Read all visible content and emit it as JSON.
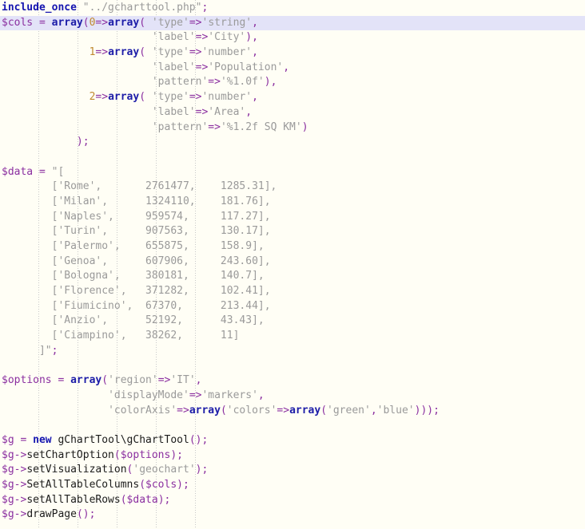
{
  "editor": {
    "title": "PHP Code Listing",
    "language": "php",
    "background_color": "#fffef5",
    "highlight_row_color": "#e3e3f8",
    "indent_guide_color": "#c9c9c9",
    "highlighted_line_index": 1,
    "indent_guide_x": [
      48,
      97,
      146,
      195,
      244
    ],
    "colors": {
      "keyword": "#1515b0",
      "function": "#1c1ca8",
      "variable": "#8b2fa0",
      "string": "#9a9a9a",
      "number": "#c08a30",
      "operator": "#8b2fa0",
      "plain": "#1c1c1c"
    },
    "lines": [
      [
        {
          "t": "include_once",
          "c": "kw"
        },
        {
          "t": " ",
          "c": "plain"
        },
        {
          "t": "\"../gcharttool.php\"",
          "c": "str"
        },
        {
          "t": ";",
          "c": "punc"
        }
      ],
      [
        {
          "t": "$cols",
          "c": "var"
        },
        {
          "t": " ",
          "c": "plain"
        },
        {
          "t": "=",
          "c": "op"
        },
        {
          "t": " ",
          "c": "plain"
        },
        {
          "t": "array",
          "c": "fn"
        },
        {
          "t": "(",
          "c": "punc"
        },
        {
          "t": "0",
          "c": "num"
        },
        {
          "t": "=>",
          "c": "op"
        },
        {
          "t": "array",
          "c": "fn"
        },
        {
          "t": "( ",
          "c": "punc"
        },
        {
          "t": "'type'",
          "c": "str"
        },
        {
          "t": "=>",
          "c": "op"
        },
        {
          "t": "'string'",
          "c": "str"
        },
        {
          "t": ",",
          "c": "punc"
        }
      ],
      [
        {
          "t": "                        ",
          "c": "plain"
        },
        {
          "t": "'label'",
          "c": "str"
        },
        {
          "t": "=>",
          "c": "op"
        },
        {
          "t": "'City'",
          "c": "str"
        },
        {
          "t": "),",
          "c": "punc"
        }
      ],
      [
        {
          "t": "              ",
          "c": "plain"
        },
        {
          "t": "1",
          "c": "num"
        },
        {
          "t": "=>",
          "c": "op"
        },
        {
          "t": "array",
          "c": "fn"
        },
        {
          "t": "( ",
          "c": "punc"
        },
        {
          "t": "'type'",
          "c": "str"
        },
        {
          "t": "=>",
          "c": "op"
        },
        {
          "t": "'number'",
          "c": "str"
        },
        {
          "t": ",",
          "c": "punc"
        }
      ],
      [
        {
          "t": "                        ",
          "c": "plain"
        },
        {
          "t": "'label'",
          "c": "str"
        },
        {
          "t": "=>",
          "c": "op"
        },
        {
          "t": "'Population'",
          "c": "str"
        },
        {
          "t": ",",
          "c": "punc"
        }
      ],
      [
        {
          "t": "                        ",
          "c": "plain"
        },
        {
          "t": "'pattern'",
          "c": "str"
        },
        {
          "t": "=>",
          "c": "op"
        },
        {
          "t": "'%1.0f'",
          "c": "str"
        },
        {
          "t": "),",
          "c": "punc"
        }
      ],
      [
        {
          "t": "              ",
          "c": "plain"
        },
        {
          "t": "2",
          "c": "num"
        },
        {
          "t": "=>",
          "c": "op"
        },
        {
          "t": "array",
          "c": "fn"
        },
        {
          "t": "( ",
          "c": "punc"
        },
        {
          "t": "'type'",
          "c": "str"
        },
        {
          "t": "=>",
          "c": "op"
        },
        {
          "t": "'number'",
          "c": "str"
        },
        {
          "t": ",",
          "c": "punc"
        }
      ],
      [
        {
          "t": "                        ",
          "c": "plain"
        },
        {
          "t": "'label'",
          "c": "str"
        },
        {
          "t": "=>",
          "c": "op"
        },
        {
          "t": "'Area'",
          "c": "str"
        },
        {
          "t": ",",
          "c": "punc"
        }
      ],
      [
        {
          "t": "                        ",
          "c": "plain"
        },
        {
          "t": "'pattern'",
          "c": "str"
        },
        {
          "t": "=>",
          "c": "op"
        },
        {
          "t": "'%1.2f SQ KM'",
          "c": "str"
        },
        {
          "t": ")",
          "c": "punc"
        }
      ],
      [
        {
          "t": "            ",
          "c": "plain"
        },
        {
          "t": ");",
          "c": "punc"
        }
      ],
      [],
      [
        {
          "t": "$data",
          "c": "var"
        },
        {
          "t": " ",
          "c": "plain"
        },
        {
          "t": "=",
          "c": "op"
        },
        {
          "t": " ",
          "c": "plain"
        },
        {
          "t": "\"[",
          "c": "str"
        }
      ],
      [
        {
          "t": "        ['Rome',       2761477,    1285.31],",
          "c": "str"
        }
      ],
      [
        {
          "t": "        ['Milan',      1324110,    181.76],",
          "c": "str"
        }
      ],
      [
        {
          "t": "        ['Naples',     959574,     117.27],",
          "c": "str"
        }
      ],
      [
        {
          "t": "        ['Turin',      907563,     130.17],",
          "c": "str"
        }
      ],
      [
        {
          "t": "        ['Palermo',    655875,     158.9],",
          "c": "str"
        }
      ],
      [
        {
          "t": "        ['Genoa',      607906,     243.60],",
          "c": "str"
        }
      ],
      [
        {
          "t": "        ['Bologna',    380181,     140.7],",
          "c": "str"
        }
      ],
      [
        {
          "t": "        ['Florence',   371282,     102.41],",
          "c": "str"
        }
      ],
      [
        {
          "t": "        ['Fiumicino',  67370,      213.44],",
          "c": "str"
        }
      ],
      [
        {
          "t": "        ['Anzio',      52192,      43.43],",
          "c": "str"
        }
      ],
      [
        {
          "t": "        ['Ciampino',   38262,      11]",
          "c": "str"
        }
      ],
      [
        {
          "t": "      ]\"",
          "c": "str"
        },
        {
          "t": ";",
          "c": "punc"
        }
      ],
      [],
      [
        {
          "t": "$options",
          "c": "var"
        },
        {
          "t": " ",
          "c": "plain"
        },
        {
          "t": "=",
          "c": "op"
        },
        {
          "t": " ",
          "c": "plain"
        },
        {
          "t": "array",
          "c": "fn"
        },
        {
          "t": "(",
          "c": "punc"
        },
        {
          "t": "'region'",
          "c": "str"
        },
        {
          "t": "=>",
          "c": "op"
        },
        {
          "t": "'IT'",
          "c": "str"
        },
        {
          "t": ",",
          "c": "punc"
        }
      ],
      [
        {
          "t": "                 ",
          "c": "plain"
        },
        {
          "t": "'displayMode'",
          "c": "str"
        },
        {
          "t": "=>",
          "c": "op"
        },
        {
          "t": "'markers'",
          "c": "str"
        },
        {
          "t": ",",
          "c": "punc"
        }
      ],
      [
        {
          "t": "                 ",
          "c": "plain"
        },
        {
          "t": "'colorAxis'",
          "c": "str"
        },
        {
          "t": "=>",
          "c": "op"
        },
        {
          "t": "array",
          "c": "fn"
        },
        {
          "t": "(",
          "c": "punc"
        },
        {
          "t": "'colors'",
          "c": "str"
        },
        {
          "t": "=>",
          "c": "op"
        },
        {
          "t": "array",
          "c": "fn"
        },
        {
          "t": "(",
          "c": "punc"
        },
        {
          "t": "'green'",
          "c": "str"
        },
        {
          "t": ",",
          "c": "punc"
        },
        {
          "t": "'blue'",
          "c": "str"
        },
        {
          "t": ")));",
          "c": "punc"
        }
      ],
      [],
      [
        {
          "t": "$g",
          "c": "var"
        },
        {
          "t": " ",
          "c": "plain"
        },
        {
          "t": "=",
          "c": "op"
        },
        {
          "t": " ",
          "c": "plain"
        },
        {
          "t": "new",
          "c": "kw"
        },
        {
          "t": " ",
          "c": "plain"
        },
        {
          "t": "gChartTool\\gChartTool",
          "c": "cls"
        },
        {
          "t": "();",
          "c": "punc"
        }
      ],
      [
        {
          "t": "$g",
          "c": "var"
        },
        {
          "t": "->",
          "c": "op"
        },
        {
          "t": "setChartOption",
          "c": "cls"
        },
        {
          "t": "(",
          "c": "punc"
        },
        {
          "t": "$options",
          "c": "var"
        },
        {
          "t": ");",
          "c": "punc"
        }
      ],
      [
        {
          "t": "$g",
          "c": "var"
        },
        {
          "t": "->",
          "c": "op"
        },
        {
          "t": "setVisualization",
          "c": "cls"
        },
        {
          "t": "(",
          "c": "punc"
        },
        {
          "t": "'geochart'",
          "c": "str"
        },
        {
          "t": ");",
          "c": "punc"
        }
      ],
      [
        {
          "t": "$g",
          "c": "var"
        },
        {
          "t": "->",
          "c": "op"
        },
        {
          "t": "SetAllTableColumns",
          "c": "cls"
        },
        {
          "t": "(",
          "c": "punc"
        },
        {
          "t": "$cols",
          "c": "var"
        },
        {
          "t": ");",
          "c": "punc"
        }
      ],
      [
        {
          "t": "$g",
          "c": "var"
        },
        {
          "t": "->",
          "c": "op"
        },
        {
          "t": "setAllTableRows",
          "c": "cls"
        },
        {
          "t": "(",
          "c": "punc"
        },
        {
          "t": "$data",
          "c": "var"
        },
        {
          "t": ");",
          "c": "punc"
        }
      ],
      [
        {
          "t": "$g",
          "c": "var"
        },
        {
          "t": "->",
          "c": "op"
        },
        {
          "t": "drawPage",
          "c": "cls"
        },
        {
          "t": "();",
          "c": "punc"
        }
      ]
    ]
  },
  "chart_source": {
    "region": "IT",
    "display_mode": "markers",
    "colors": [
      "green",
      "blue"
    ],
    "columns": [
      {
        "type": "string",
        "label": "City"
      },
      {
        "type": "number",
        "label": "Population",
        "pattern": "%1.0f"
      },
      {
        "type": "number",
        "label": "Area",
        "pattern": "%1.2f SQ KM"
      }
    ],
    "rows": [
      {
        "city": "Rome",
        "population": 2761477,
        "area": 1285.31
      },
      {
        "city": "Milan",
        "population": 1324110,
        "area": 181.76
      },
      {
        "city": "Naples",
        "population": 959574,
        "area": 117.27
      },
      {
        "city": "Turin",
        "population": 907563,
        "area": 130.17
      },
      {
        "city": "Palermo",
        "population": 655875,
        "area": 158.9
      },
      {
        "city": "Genoa",
        "population": 607906,
        "area": 243.6
      },
      {
        "city": "Bologna",
        "population": 380181,
        "area": 140.7
      },
      {
        "city": "Florence",
        "population": 371282,
        "area": 102.41
      },
      {
        "city": "Fiumicino",
        "population": 67370,
        "area": 213.44
      },
      {
        "city": "Anzio",
        "population": 52192,
        "area": 43.43
      },
      {
        "city": "Ciampino",
        "population": 38262,
        "area": 11
      }
    ]
  }
}
